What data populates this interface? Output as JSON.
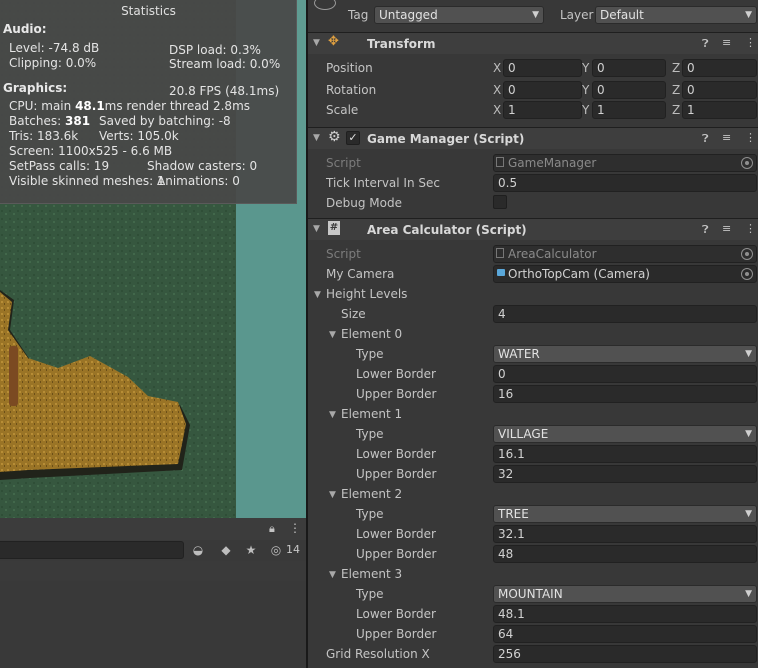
{
  "stats": {
    "title": "Statistics",
    "audio_heading": "Audio:",
    "level": "Level: -74.8 dB",
    "clipping": "Clipping: 0.0%",
    "dsp_load": "DSP load: 0.3%",
    "stream_load": "Stream load: 0.0%",
    "graphics_heading": "Graphics:",
    "fps": "20.8 FPS (48.1ms)",
    "cpu_prefix": "CPU: main ",
    "cpu_main": "48.1",
    "cpu_suffix": "ms  render thread 2.8ms",
    "batches_prefix": "Batches: ",
    "batches": "381",
    "saved_batching": "Saved by batching: -8",
    "tris": "Tris: 183.6k",
    "verts": "Verts: 105.0k",
    "screen": "Screen: 1100x525 - 6.6 MB",
    "setpass": "SetPass calls: 19",
    "shadow_casters": "Shadow casters: 0",
    "skinned_meshes": "Visible skinned meshes: 1",
    "animations": "Animations: 0"
  },
  "hierarchy": {
    "hidden_count": "14"
  },
  "object": {
    "tag_label": "Tag",
    "tag_value": "Untagged",
    "layer_label": "Layer",
    "layer_value": "Default"
  },
  "transform": {
    "title": "Transform",
    "position_label": "Position",
    "rotation_label": "Rotation",
    "scale_label": "Scale",
    "x": "X",
    "y": "Y",
    "z": "Z",
    "position": [
      "0",
      "0",
      "0"
    ],
    "rotation": [
      "0",
      "0",
      "0"
    ],
    "scale": [
      "1",
      "1",
      "1"
    ]
  },
  "game_manager": {
    "title": "Game Manager (Script)",
    "script_label": "Script",
    "script_value": "GameManager",
    "tick_label": "Tick Interval In Sec",
    "tick_value": "0.5",
    "debug_label": "Debug Mode"
  },
  "area_calculator": {
    "title": "Area Calculator (Script)",
    "script_label": "Script",
    "script_value": "AreaCalculator",
    "camera_label": "My Camera",
    "camera_value": "OrthoTopCam (Camera)",
    "height_levels_label": "Height Levels",
    "size_label": "Size",
    "size_value": "4",
    "type_label": "Type",
    "lower_label": "Lower Border",
    "upper_label": "Upper Border",
    "elements": [
      {
        "name": "Element 0",
        "type": "WATER",
        "lower": "0",
        "upper": "16"
      },
      {
        "name": "Element 1",
        "type": "VILLAGE",
        "lower": "16.1",
        "upper": "32"
      },
      {
        "name": "Element 2",
        "type": "TREE",
        "lower": "32.1",
        "upper": "48"
      },
      {
        "name": "Element 3",
        "type": "MOUNTAIN",
        "lower": "48.1",
        "upper": "64"
      }
    ],
    "grid_res_label": "Grid Resolution X",
    "grid_res_value": "256"
  }
}
